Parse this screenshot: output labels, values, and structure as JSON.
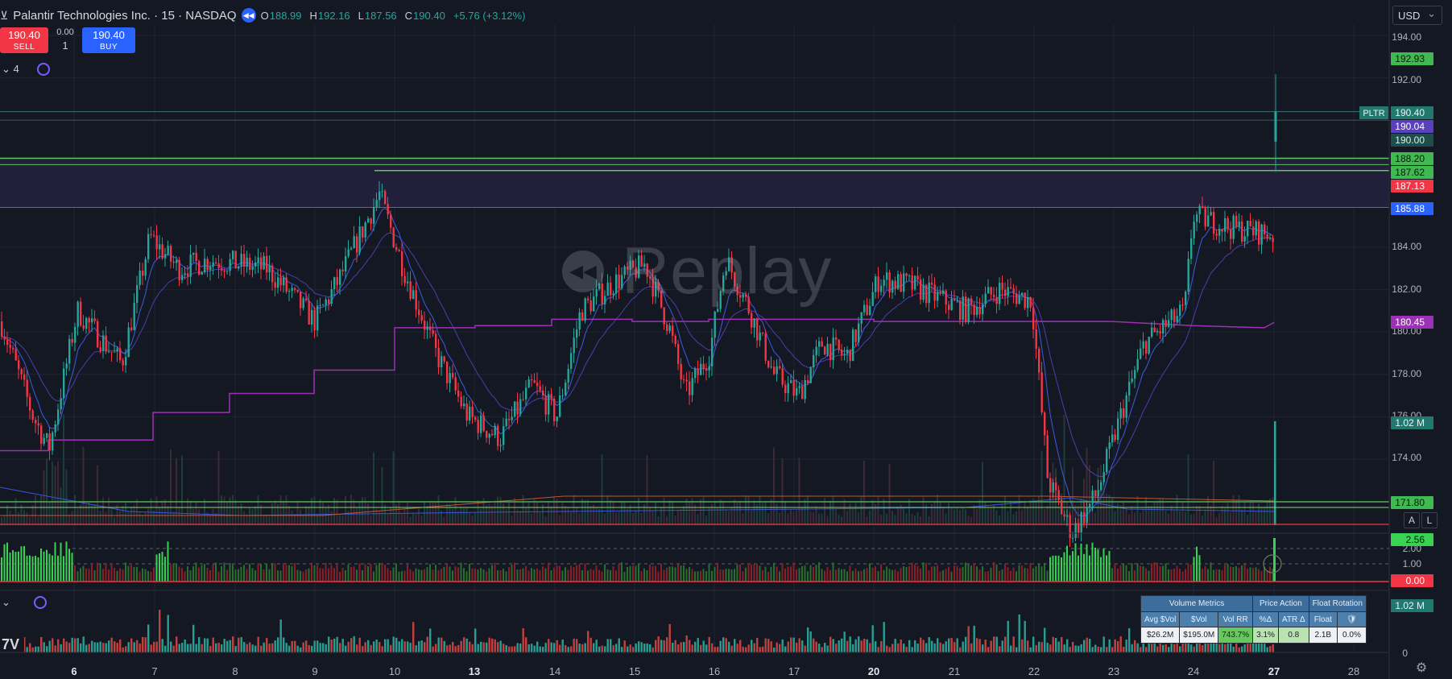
{
  "header": {
    "symbol_title": "Palantir Technologies Inc. · 15 · NASDAQ",
    "ohlc": [
      {
        "k": "O",
        "v": "188.99"
      },
      {
        "k": "H",
        "v": "192.16"
      },
      {
        "k": "L",
        "v": "187.56"
      },
      {
        "k": "C",
        "v": "190.40"
      }
    ],
    "change": "+5.76 (+3.12%)",
    "collapse_count": "4"
  },
  "trade": {
    "sell_price": "190.40",
    "sell_label": "SELL",
    "buy_price": "190.40",
    "buy_label": "BUY",
    "spread": "0.00",
    "quantity": "1"
  },
  "currency": "USD",
  "watermark": "Replay",
  "colors": {
    "up": "#26a69a",
    "down": "#f23645",
    "bright_green": "#39d353",
    "green_line": "#5ec85c",
    "purple": "#9b31b4",
    "blue": "#2962ff",
    "bg": "#141823"
  },
  "axis": {
    "price_ticks": [
      "194.00",
      "192.00",
      "184.00",
      "182.00",
      "180.00",
      "178.00",
      "176.00",
      "174.00",
      "171.80"
    ],
    "date_ticks": [
      "6",
      "7",
      "8",
      "9",
      "10",
      "13",
      "14",
      "15",
      "16",
      "17",
      "20",
      "21",
      "22",
      "23",
      "24",
      "27",
      "28"
    ],
    "bold_dates": [
      "6",
      "13",
      "20",
      "27"
    ],
    "osc_ticks": [
      "2.00",
      "1.00"
    ],
    "vol_zero": "0"
  },
  "price_labels": [
    {
      "text": "192.93",
      "bg": "#3fb950",
      "fg": "#0c1a0c"
    },
    {
      "text": "190.40",
      "bg": "#22786e",
      "fg": "#e7f6f3",
      "tag": "PLTR"
    },
    {
      "text": "190.04",
      "bg": "#5a3fbf",
      "fg": "#ffffff"
    },
    {
      "text": "190.00",
      "bg": "#1f4d4a",
      "fg": "#d8f0ec"
    },
    {
      "text": "188.20",
      "bg": "#3fb950",
      "fg": "#0c1a0c"
    },
    {
      "text": "187.62",
      "bg": "#3fb950",
      "fg": "#0c1a0c"
    },
    {
      "text": "187.13",
      "bg": "#f23645",
      "fg": "#ffffff"
    },
    {
      "text": "185.88",
      "bg": "#2962ff",
      "fg": "#ffffff"
    },
    {
      "text": "180.45",
      "bg": "#9b31b4",
      "fg": "#ffffff"
    },
    {
      "text": "1.02 M",
      "bg": "#22786e",
      "fg": "#e7f6f3"
    },
    {
      "text": "171.80",
      "bg": "#3fb950",
      "fg": "#0c1a0c"
    },
    {
      "text": "2.56",
      "bg": "#39d353",
      "fg": "#0c1a0c"
    },
    {
      "text": "0.00",
      "bg": "#f23645",
      "fg": "#ffffff"
    },
    {
      "text": "1.02 M",
      "bg": "#22786e",
      "fg": "#e7f6f3"
    }
  ],
  "metrics": {
    "groups": [
      "Volume Metrics",
      "Price Action",
      "Float Rotation"
    ],
    "columns": [
      "Avg $Vol",
      "$Vol",
      "Vol RR",
      "%Δ",
      "ATR Δ",
      "Float",
      "🛡"
    ],
    "values": [
      "$26.2M",
      "$195.0M",
      "743.7%",
      "3.1%",
      "0.8",
      "2.1B",
      "0.0%"
    ]
  },
  "buttons": {
    "auto": "A",
    "log": "L"
  }
}
